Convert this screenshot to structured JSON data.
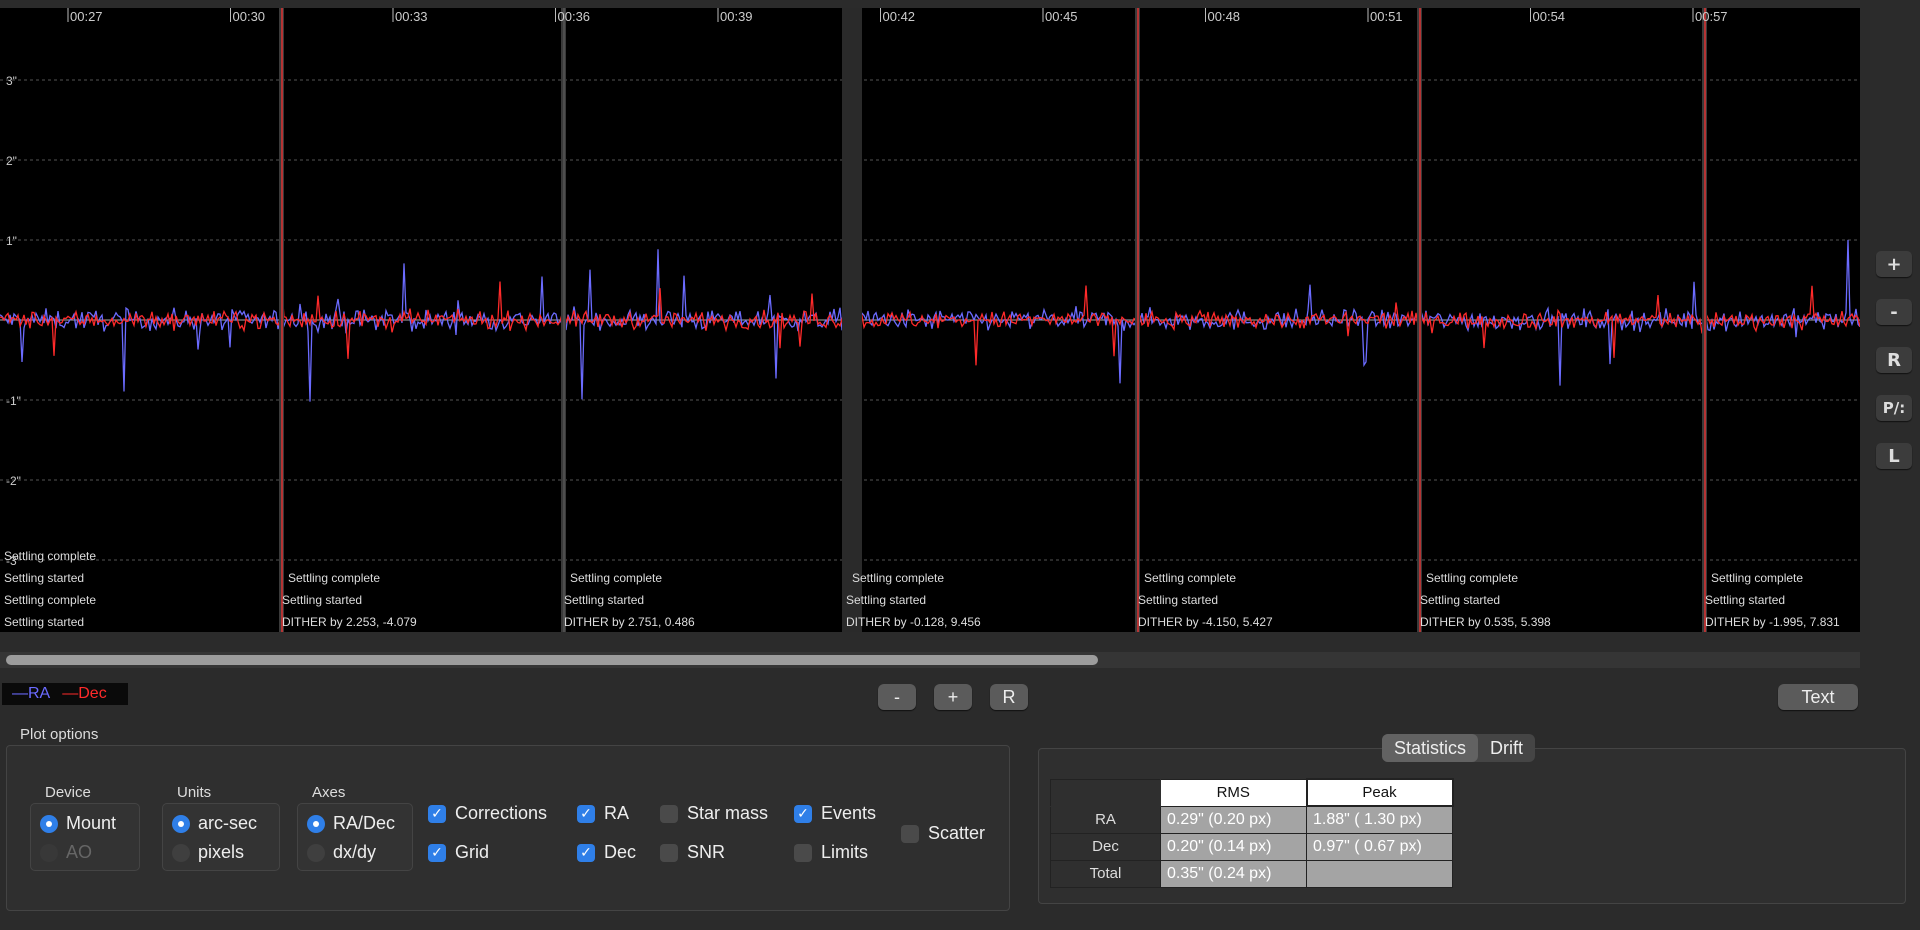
{
  "chart_data": {
    "type": "line",
    "x_ticks": [
      "00:27",
      "00:30",
      "00:33",
      "00:36",
      "00:39",
      "00:42",
      "00:45",
      "00:48",
      "00:51",
      "00:54",
      "00:57"
    ],
    "y_ticks": [
      "3\"",
      "2\"",
      "1\"",
      "-1\"",
      "-2\"",
      "-3\""
    ],
    "series": [
      {
        "name": "RA",
        "color": "#6b6bff"
      },
      {
        "name": "Dec",
        "color": "#ff2a2a"
      }
    ],
    "events": [
      {
        "lines": [
          "Settling complete",
          "Settling started",
          "Settling complete",
          "Settling started"
        ]
      },
      {
        "lines": [
          "Settling complete",
          "Settling started",
          "DITHER by 2.253, -4.079"
        ]
      },
      {
        "lines": [
          "Settling complete",
          "Settling started",
          "DITHER by 2.751, 0.486"
        ]
      },
      {
        "lines": [
          "Settling complete",
          "Settling started",
          "DITHER by -0.128, 9.456"
        ]
      },
      {
        "lines": [
          "Settling complete",
          "Settling started",
          "DITHER by -4.150, 5.427"
        ]
      },
      {
        "lines": [
          "Settling complete",
          "Settling started",
          "DITHER by 0.535, 5.398"
        ]
      },
      {
        "lines": [
          "Settling complete",
          "Settling started",
          "DITHER by -1.995, 7.831"
        ]
      }
    ]
  },
  "side_buttons": [
    "+",
    "-",
    "R",
    "P/:",
    "L"
  ],
  "legend": {
    "ra": "—RA",
    "dec": "—Dec",
    "ra_color": "#6b6bff",
    "dec_color": "#ff2a2a"
  },
  "zoom_buttons": {
    "minus": "-",
    "plus": "+",
    "reset": "R"
  },
  "text_button": "Text",
  "plot_options": {
    "title": "Plot options",
    "device": {
      "label": "Device",
      "mount": "Mount",
      "ao": "AO"
    },
    "units": {
      "label": "Units",
      "arcsec": "arc-sec",
      "pixels": "pixels"
    },
    "axes": {
      "label": "Axes",
      "radec": "RA/Dec",
      "dxdy": "dx/dy"
    },
    "checks": {
      "corrections": "Corrections",
      "grid": "Grid",
      "ra": "RA",
      "dec": "Dec",
      "star_mass": "Star mass",
      "snr": "SNR",
      "events": "Events",
      "limits": "Limits",
      "scatter": "Scatter"
    }
  },
  "stats": {
    "tabs": [
      "Statistics",
      "Drift"
    ],
    "col_rms": "RMS",
    "col_peak": "Peak",
    "rows": [
      {
        "name": "RA",
        "rms": "0.29\" (0.20 px)",
        "peak": "1.88\" ( 1.30 px)"
      },
      {
        "name": "Dec",
        "rms": "0.20\" (0.14 px)",
        "peak": "0.97\" ( 0.67 px)"
      },
      {
        "name": "Total",
        "rms": "0.35\" (0.24 px)",
        "peak": ""
      }
    ]
  }
}
